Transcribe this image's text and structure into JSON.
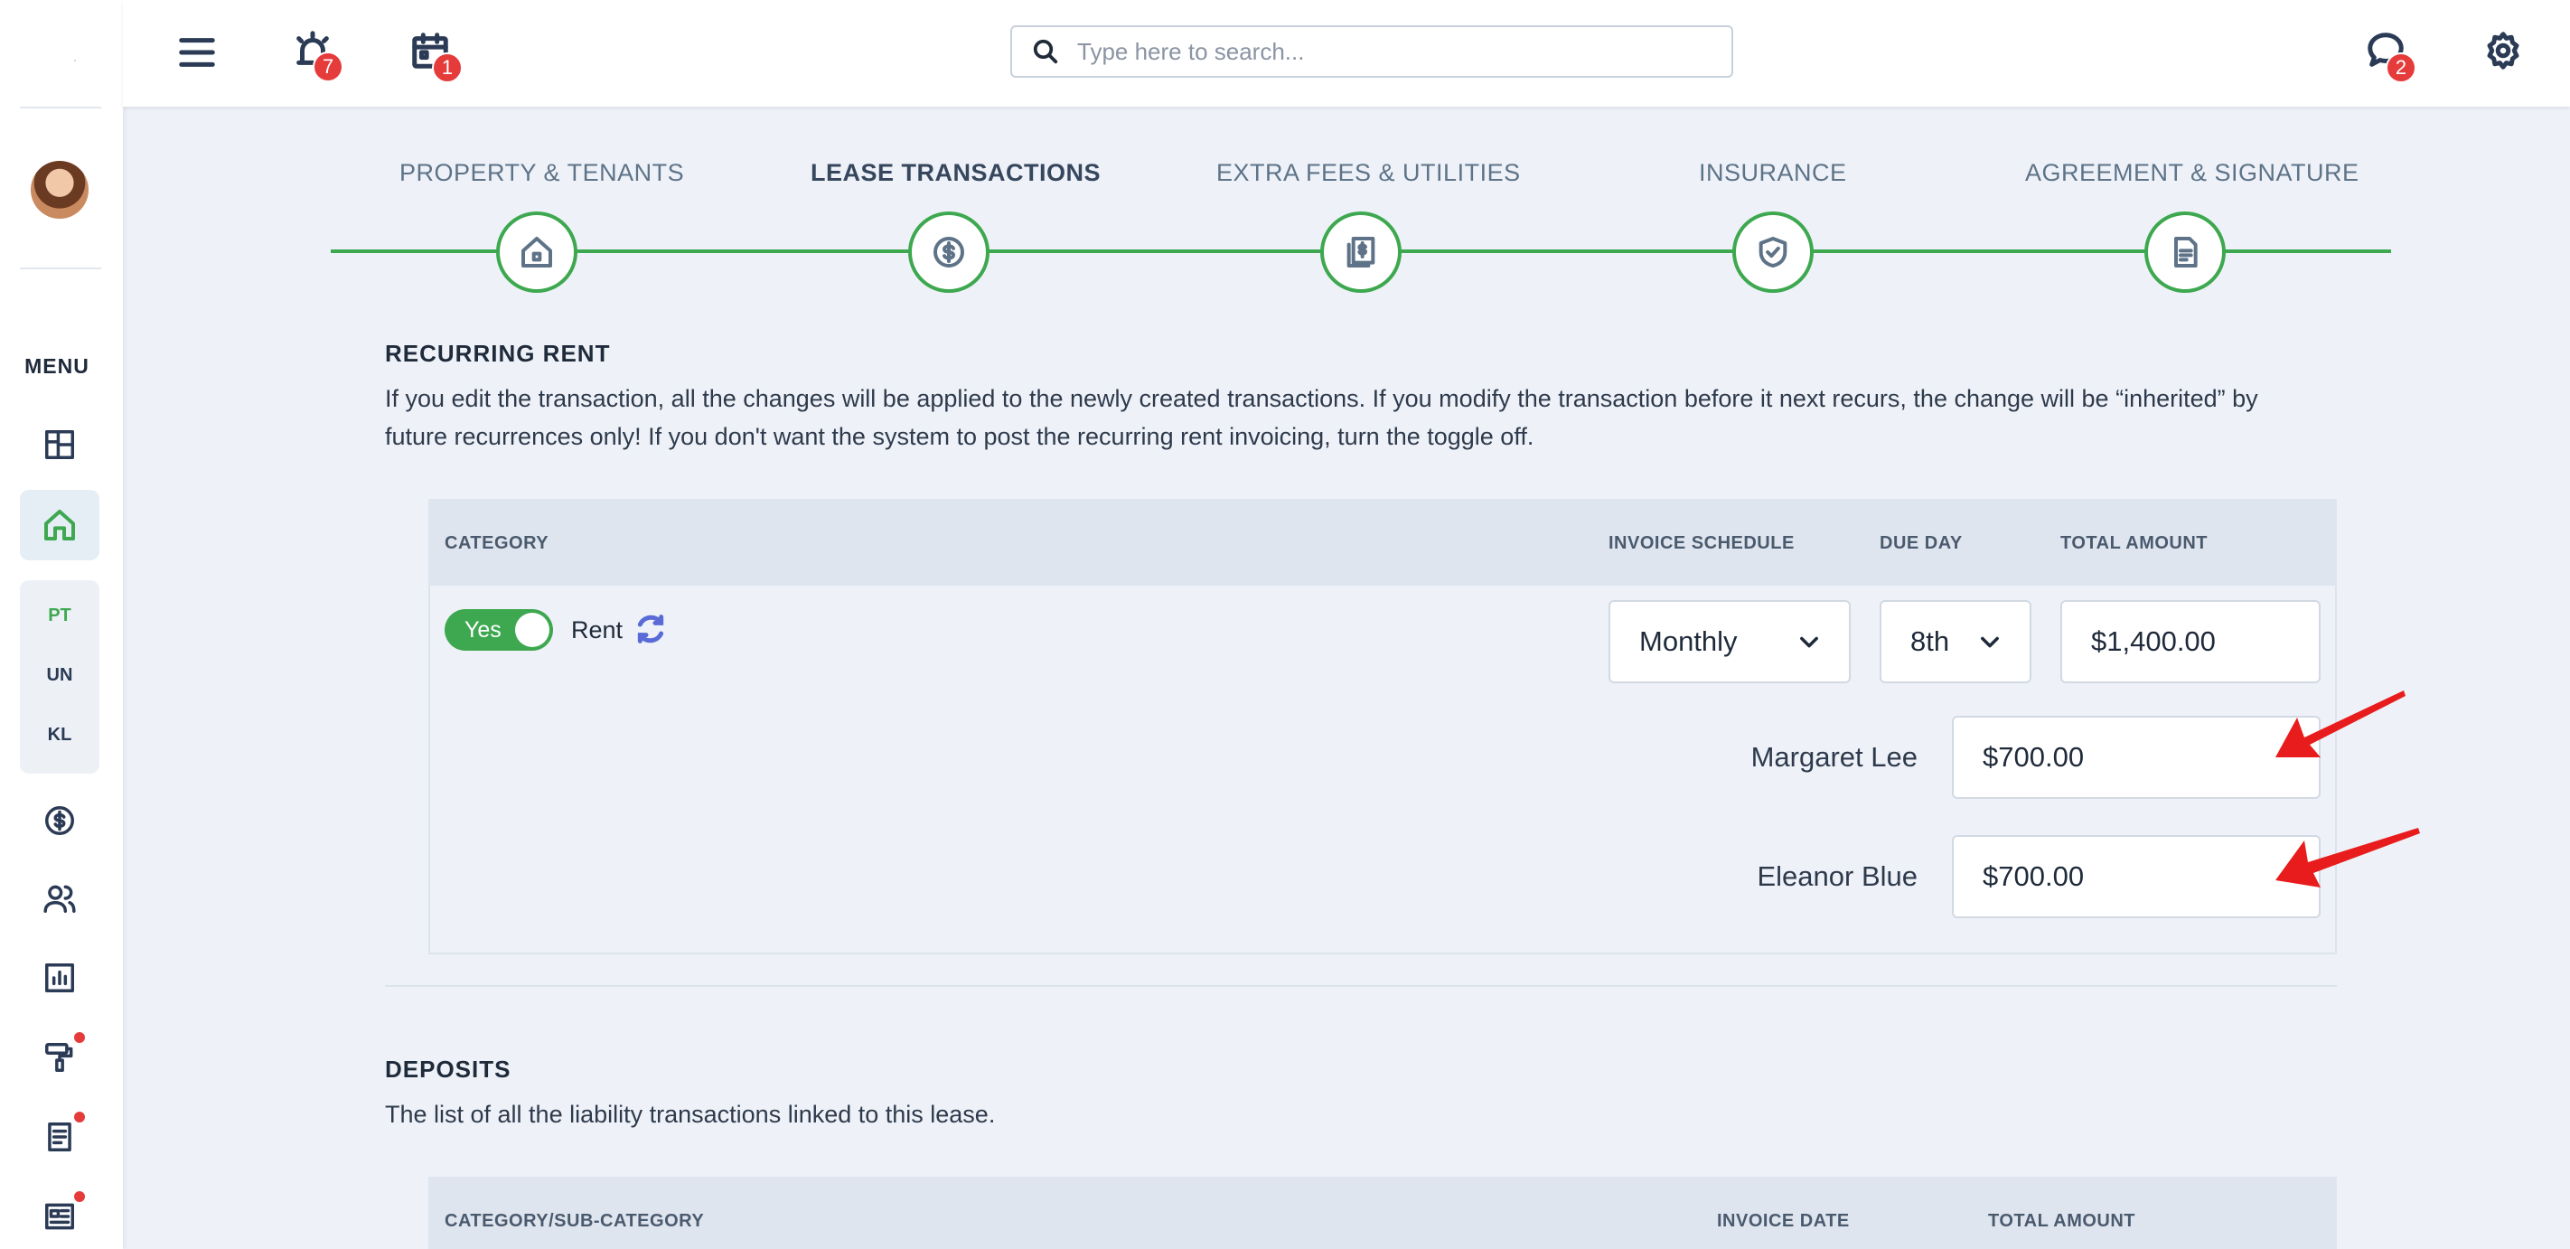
{
  "sidebar": {
    "menu_label": "MENU",
    "sub_items": [
      "PT",
      "UN",
      "KL"
    ],
    "icons": [
      "dashboard-icon",
      "home-icon",
      "dollar-icon",
      "users-icon",
      "chart-icon",
      "paint-roller-icon",
      "document-icon",
      "newspaper-icon"
    ]
  },
  "topbar": {
    "search_placeholder": "Type here to search...",
    "alerts_count": "7",
    "calendar_count": "1",
    "messages_count": "2"
  },
  "steps": [
    {
      "label": "PROPERTY & TENANTS",
      "icon": "house-icon"
    },
    {
      "label": "LEASE TRANSACTIONS",
      "icon": "dollar-icon"
    },
    {
      "label": "EXTRA FEES & UTILITIES",
      "icon": "receipt-icon"
    },
    {
      "label": "INSURANCE",
      "icon": "shield-icon"
    },
    {
      "label": "AGREEMENT & SIGNATURE",
      "icon": "document-icon"
    }
  ],
  "recurring_rent": {
    "title": "RECURRING RENT",
    "desc_line1": "If you edit the transaction, all the changes will be applied to the newly created transactions. If you modify the transaction before it next recurs, the change will be “inherited” by",
    "desc_line2": "future recurrences only! If you don't want the system to post the recurring rent invoicing, turn the toggle off.",
    "headers": {
      "category": "CATEGORY",
      "invoice_schedule": "INVOICE SCHEDULE",
      "due_day": "DUE DAY",
      "total_amount": "TOTAL AMOUNT"
    },
    "toggle_label": "Yes",
    "category": "Rent",
    "schedule": "Monthly",
    "due_day": "8th",
    "total": "$1,400.00",
    "tenants": [
      {
        "name": "Margaret Lee",
        "amount": "$700.00"
      },
      {
        "name": "Eleanor Blue",
        "amount": "$700.00"
      }
    ]
  },
  "deposits": {
    "title": "DEPOSITS",
    "desc": "The list of all the liability transactions linked to this lease.",
    "headers": {
      "category": "CATEGORY/SUB-CATEGORY",
      "invoice_date": "INVOICE DATE",
      "total_amount": "TOTAL AMOUNT"
    }
  },
  "colors": {
    "accent_green": "#3da84f",
    "badge_red": "#e53b3b",
    "arrow_red": "#e81c1c"
  }
}
